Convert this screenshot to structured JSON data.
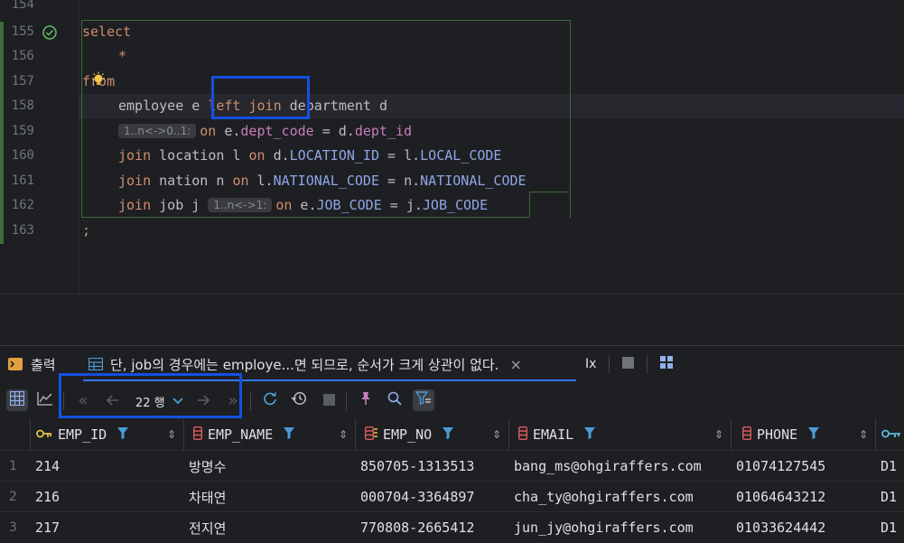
{
  "editor": {
    "line_numbers": [
      "154",
      "155",
      "156",
      "157",
      "158",
      "159",
      "160",
      "161",
      "162",
      "163"
    ],
    "lines": {
      "l155": {
        "kw": "select"
      },
      "l156": {
        "star": "*"
      },
      "l157": {
        "kw": "from"
      },
      "l158": {
        "a": "employee e ",
        "kw": "left join",
        "b": " department d"
      },
      "l159": {
        "hint": "1..n<->0..1:",
        "kw": "on",
        "a": " e.",
        "f": "dept_code",
        "b": " = d.",
        "f2": "dept_id"
      },
      "l160": {
        "kw": "join",
        "a": " location l ",
        "kw2": "on",
        "b": " d.",
        "c1": "LOCATION_ID",
        "c": " = l.",
        "c2": "LOCAL_CODE"
      },
      "l161": {
        "kw": "join",
        "a": " nation n ",
        "kw2": "on",
        "b": " l.",
        "c1": "NATIONAL_CODE",
        "c": " = n.",
        "c2": "NATIONAL_CODE"
      },
      "l162": {
        "kw": "join",
        "a": " job j ",
        "hint": "1..n<->1:",
        "kw2": "on",
        "b": " e.",
        "c1": "JOB_CODE",
        "c": " = j.",
        "c2": "JOB_CODE"
      },
      "l163": {
        "semi": ";"
      }
    }
  },
  "tabs": {
    "output_label": "출력",
    "result_label": "단, job의 경우에는 employe...면 되므로, 순서가 크게 상관이 없다.",
    "close_glyph": "×",
    "ix_label": "Ix"
  },
  "toolbar": {
    "row_count": "22 행"
  },
  "table": {
    "columns": [
      {
        "name": "EMP_ID",
        "icon": "key-icon"
      },
      {
        "name": "EMP_NAME",
        "icon": "column-icon"
      },
      {
        "name": "EMP_NO",
        "icon": "index-column-icon"
      },
      {
        "name": "EMAIL",
        "icon": "column-icon"
      },
      {
        "name": "PHONE",
        "icon": "column-icon"
      }
    ],
    "rows": [
      {
        "num": "1",
        "emp_id": "214",
        "emp_name": "방명수",
        "emp_no": "850705-1313513",
        "email": "bang_ms@ohgiraffers.com",
        "phone": "01074127545",
        "dept": "D1"
      },
      {
        "num": "2",
        "emp_id": "216",
        "emp_name": "차태연",
        "emp_no": "000704-3364897",
        "email": "cha_ty@ohgiraffers.com",
        "phone": "01064643212",
        "dept": "D1"
      },
      {
        "num": "3",
        "emp_id": "217",
        "emp_name": "전지연",
        "emp_no": "770808-2665412",
        "email": "jun_jy@ohgiraffers.com",
        "phone": "01033624442",
        "dept": "D1"
      }
    ]
  },
  "colors": {
    "keyword": "#cf8e6d",
    "field": "#c77dbb",
    "column_ref": "#8fa6e8",
    "highlight_box": "#1550e0",
    "accent": "#3574f0"
  }
}
